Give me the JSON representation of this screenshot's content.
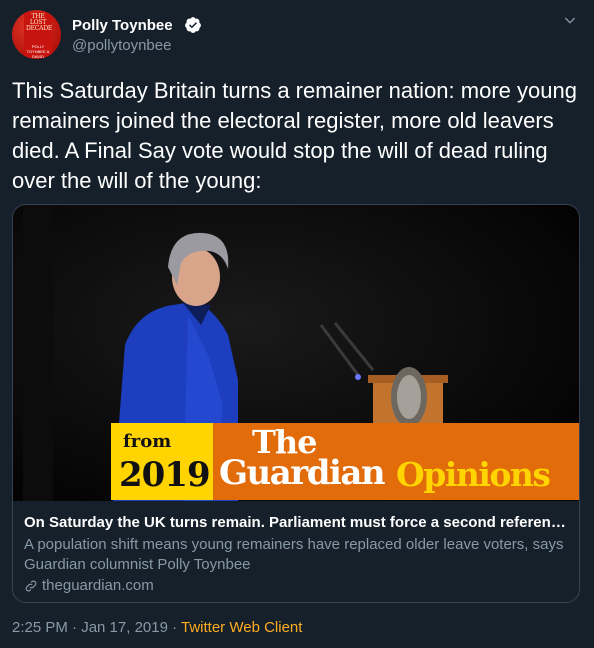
{
  "author": {
    "name": "Polly Toynbee",
    "handle": "@pollytoynbee",
    "verified": true,
    "avatar_title": "THE LOST DECADE",
    "avatar_authors": "POLLY TOYNBEE & DAVID WALKER"
  },
  "tweet": {
    "text": "This Saturday Britain turns a remainer nation: more young remainers joined the electoral register, more old leavers died. A Final Say vote would stop the will of dead ruling over the will of the young:"
  },
  "card": {
    "banner": {
      "from": "from",
      "year": "2019",
      "the": "The",
      "guardian": "Guardian",
      "opinions": "Opinions"
    },
    "title": "On Saturday the UK turns remain. Parliament must force a second referendum | ...",
    "description": "A population shift means young remainers have replaced older leave voters, says Guardian columnist Polly Toynbee",
    "domain": "theguardian.com"
  },
  "meta": {
    "time": "2:25 PM · Jan 17, 2019 · ",
    "client": "Twitter Web Client"
  },
  "colors": {
    "background": "#15202b",
    "secondary_text": "#8899a6",
    "verified": "#ffffff",
    "banner_orange": "#e26b0a",
    "banner_yellow": "#ffd400",
    "client_link": "#ffad1f"
  },
  "icons": [
    "verified-badge-icon",
    "chevron-down-icon",
    "link-icon"
  ]
}
